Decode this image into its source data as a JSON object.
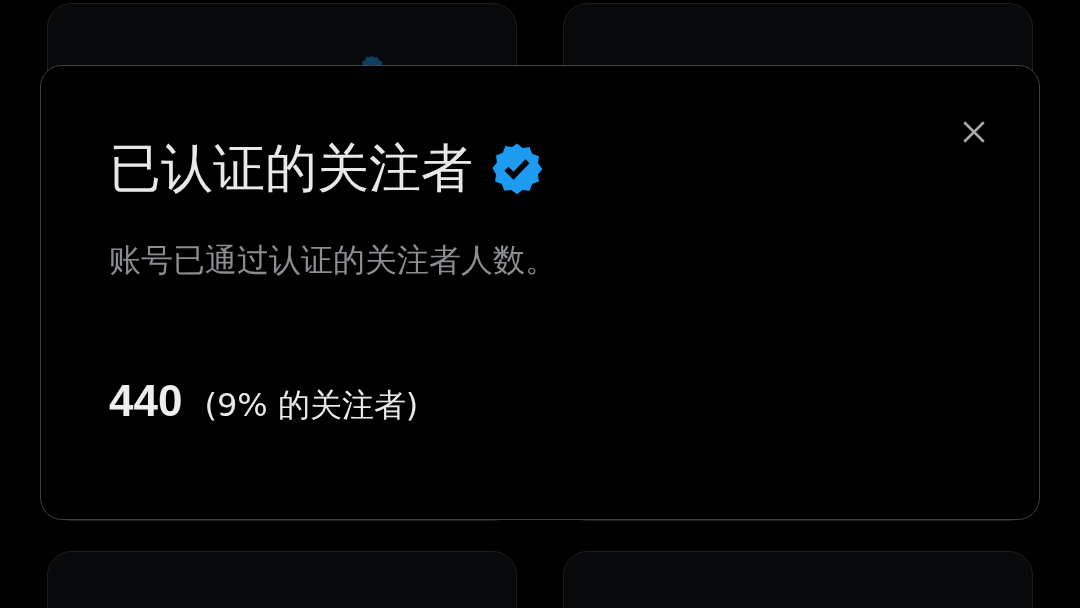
{
  "background_cards": [
    {
      "verified": true
    },
    {
      "verified": false
    },
    {
      "verified": false
    },
    {
      "verified": false
    }
  ],
  "dialog": {
    "title": "已认证的关注者",
    "verified": true,
    "description": "账号已通过认证的关注者人数。",
    "value": "440",
    "share": "(9% 的关注者)"
  }
}
